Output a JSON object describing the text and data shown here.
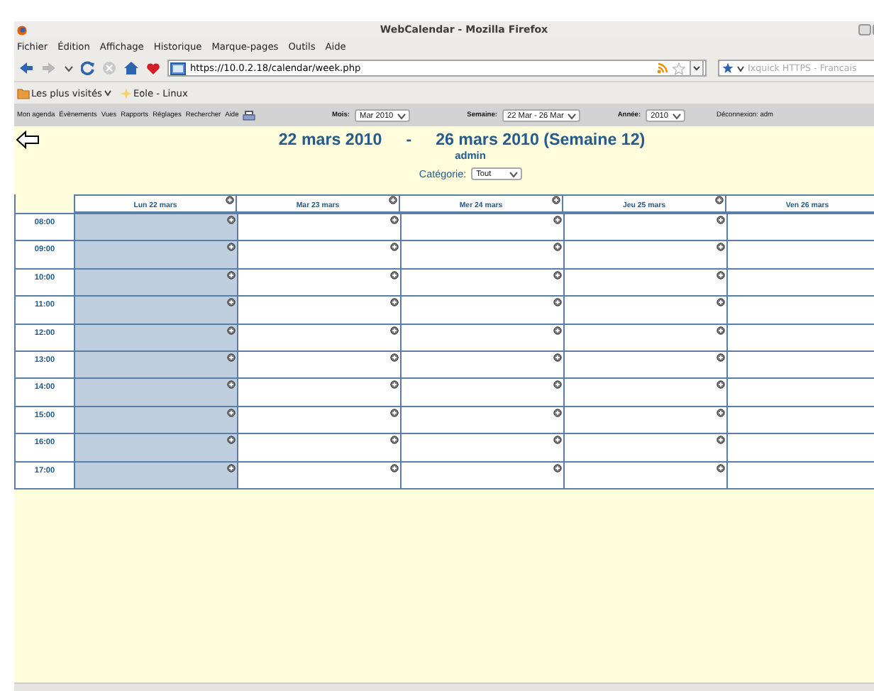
{
  "window": {
    "title": "WebCalendar - Mozilla Firefox"
  },
  "menu": [
    "Fichier",
    "Édition",
    "Affichage",
    "Historique",
    "Marque-pages",
    "Outils",
    "Aide"
  ],
  "toolbar": {
    "url": "https://10.0.2.18/calendar/week.php",
    "search_placeholder": "Ixquick HTTPS - Francais"
  },
  "bookmarks": [
    "Les plus visités",
    "Eole - Linux"
  ],
  "app_menu": [
    "Mon agenda",
    "Évènements",
    "Vues",
    "Rapports",
    "Réglages",
    "Rechercher",
    "Aide"
  ],
  "selectors": [
    {
      "label": "Mois:",
      "value": "Mar 2010"
    },
    {
      "label": "Semaine:",
      "value": "22 Mar - 26 Mar"
    },
    {
      "label": "Année:",
      "value": "2010"
    }
  ],
  "logout": "Déconnexion: adm",
  "heading": {
    "start": "22 mars 2010",
    "separator": "-",
    "end": "26 mars 2010 (Semaine 12)",
    "user": "admin"
  },
  "category": {
    "label": "Catégorie:",
    "value": "Tout"
  },
  "days": [
    {
      "label": "Lun 22 mars",
      "today": true
    },
    {
      "label": "Mar 23 mars",
      "today": false
    },
    {
      "label": "Mer 24 mars",
      "today": false
    },
    {
      "label": "Jeu 25 mars",
      "today": false
    },
    {
      "label": "Ven 26 mars",
      "today": false
    }
  ],
  "hours": [
    "08:00",
    "09:00",
    "10:00",
    "11:00",
    "12:00",
    "13:00",
    "14:00",
    "15:00",
    "16:00",
    "17:00"
  ]
}
